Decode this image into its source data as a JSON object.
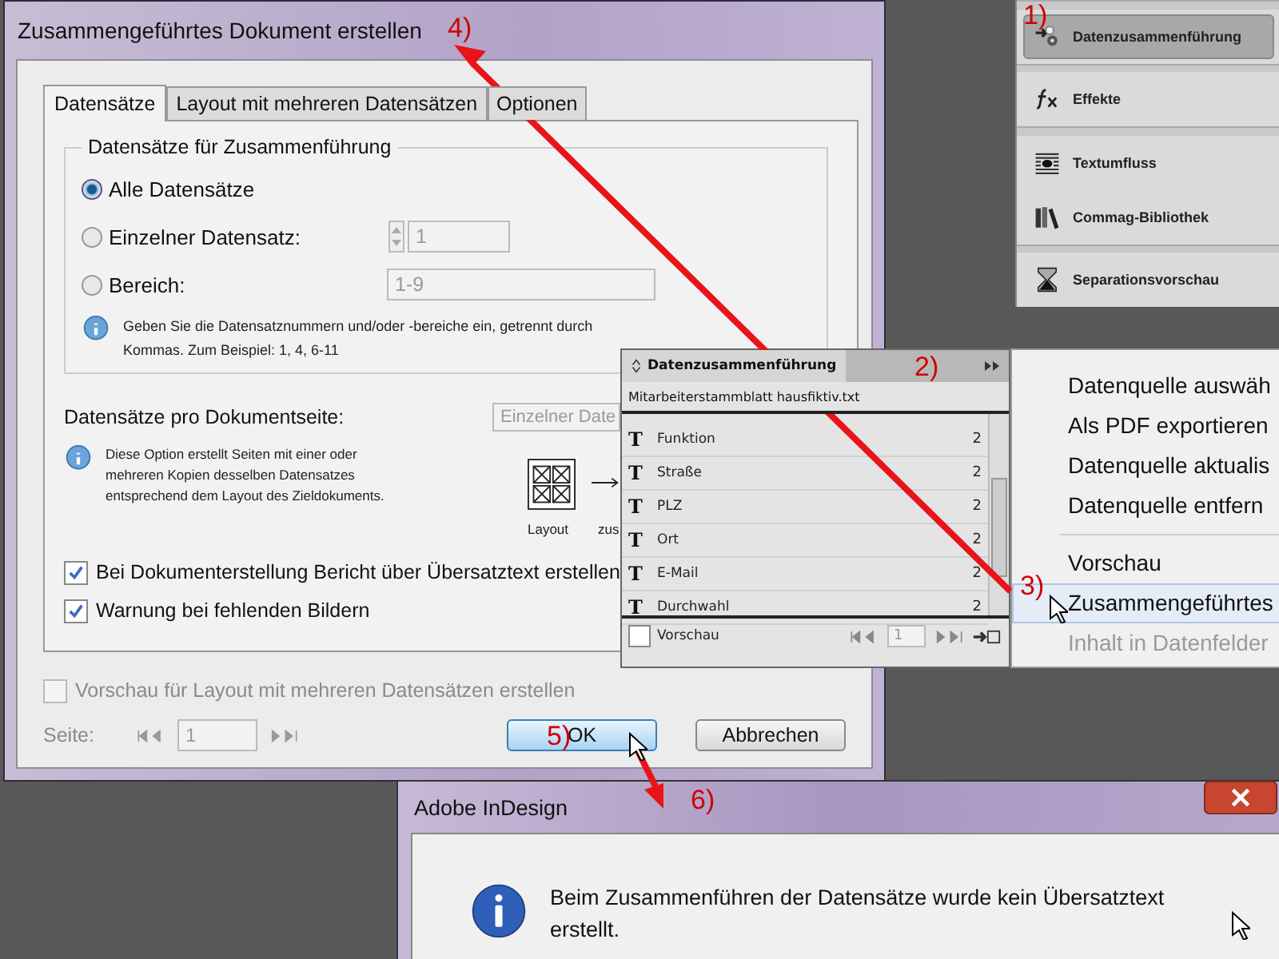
{
  "dialog": {
    "title": "Zusammengeführtes Dokument erstellen",
    "tabs": [
      {
        "label": "Datensätze",
        "selected": true
      },
      {
        "label": "Layout mit mehreren Datensätzen",
        "selected": false
      },
      {
        "label": "Optionen",
        "selected": false
      }
    ],
    "group_title": "Datensätze für Zusammenführung",
    "radios": [
      {
        "label": "Alle Datensätze",
        "selected": true,
        "kind": "plain"
      },
      {
        "label": "Einzelner Datensatz:",
        "selected": false,
        "kind": "spinner",
        "value": "1"
      },
      {
        "label": "Bereich:",
        "selected": false,
        "kind": "field",
        "value": "1-9"
      }
    ],
    "range_hint": "Geben Sie die Datensatznummern und/oder -bereiche ein, getrennt durch Kommas. Zum Beispiel: 1, 4, 6-11",
    "per_page_label": "Datensätze pro Dokumentseite:",
    "per_page_value": "Einzelner Date",
    "layout_hint": "Diese Option erstellt Seiten mit einer oder mehreren Kopien desselben Datensatzes entsprechend dem Layout des Zieldokuments.",
    "diagram_labels": [
      "Layout",
      "zus"
    ],
    "checkboxes": [
      {
        "label": "Bei Dokumenterstellung Bericht über Übersatztext erstellen",
        "checked": true
      },
      {
        "label": "Warnung bei fehlenden Bildern",
        "checked": true
      }
    ],
    "preview_checkbox": {
      "label": "Vorschau für Layout mit mehreren Datensätzen erstellen",
      "checked": false
    },
    "page_label": "Seite:",
    "page_value": "1",
    "buttons": [
      {
        "label": "OK",
        "default": true
      },
      {
        "label": "Abbrechen",
        "default": false
      }
    ]
  },
  "dock": [
    {
      "label": "Datenzusammenführung",
      "kind": "merge",
      "selected": true
    },
    {
      "label": "Effekte",
      "kind": "fx",
      "selected": false
    },
    {
      "label": "Textumfluss",
      "kind": "wrap",
      "selected": false
    },
    {
      "label": "Commag-Bibliothek",
      "kind": "library",
      "selected": false
    },
    {
      "label": "Separationsvorschau",
      "kind": "separation",
      "selected": false
    }
  ],
  "merge_panel": {
    "title": "Datenzusammenführung",
    "source": "Mitarbeiterstammblatt hausfiktiv.txt",
    "fields": [
      {
        "glyph": "T",
        "name": "Funktion",
        "count": "2"
      },
      {
        "glyph": "T",
        "name": "Straße",
        "count": "2"
      },
      {
        "glyph": "T",
        "name": "PLZ",
        "count": "2"
      },
      {
        "glyph": "T",
        "name": "Ort",
        "count": "2"
      },
      {
        "glyph": "T",
        "name": "E-Mail",
        "count": "2"
      },
      {
        "glyph": "T",
        "name": "Durchwahl",
        "count": "2"
      }
    ],
    "preview": {
      "label": "Vorschau",
      "checked": false
    },
    "record": "1"
  },
  "menu": [
    {
      "kind": "item",
      "label": "Datenquelle auswäh",
      "selected": false,
      "disabled": false
    },
    {
      "kind": "item",
      "label": "Als PDF exportieren",
      "selected": false,
      "disabled": false
    },
    {
      "kind": "item",
      "label": "Datenquelle aktualis",
      "selected": false,
      "disabled": false
    },
    {
      "kind": "item",
      "label": "Datenquelle entfern",
      "selected": false,
      "disabled": false
    },
    {
      "kind": "separator"
    },
    {
      "kind": "item",
      "label": "Vorschau",
      "selected": false,
      "disabled": false
    },
    {
      "kind": "item",
      "label": "Zusammengeführtes",
      "selected": true,
      "disabled": false
    },
    {
      "kind": "item",
      "label": "Inhalt in Datenfelder",
      "selected": false,
      "disabled": true
    }
  ],
  "alert": {
    "title": "Adobe InDesign",
    "message": "Beim Zusammenführen der Datensätze wurde kein Übersatztext erstellt."
  },
  "annotations": [
    "1)",
    "2)",
    "3)",
    "4)",
    "5)",
    "6)"
  ]
}
